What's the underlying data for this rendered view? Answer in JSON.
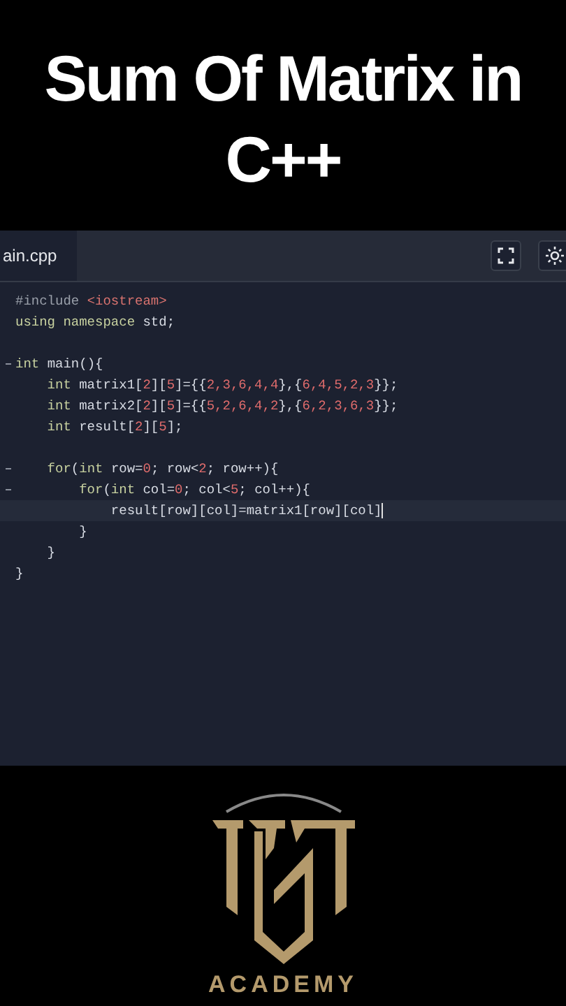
{
  "title": {
    "lines": [
      "Sum Of Matrix in",
      "C++"
    ]
  },
  "editor": {
    "tab": {
      "label": "ain.cpp"
    },
    "blocks": [
      {
        "lines": [
          {
            "tokens": [
              {
                "kind": "directive",
                "text": "#include "
              },
              {
                "kind": "string",
                "text": "<iostream>"
              }
            ]
          },
          {
            "tokens": [
              {
                "kind": "keyword",
                "text": "using namespace "
              },
              {
                "kind": "plain",
                "text": "std;"
              }
            ]
          }
        ]
      },
      {
        "lines": [
          {
            "fold": true,
            "tokens": [
              {
                "kind": "keyword",
                "text": "int "
              },
              {
                "kind": "plain",
                "text": "main(){"
              }
            ]
          },
          {
            "tokens": [
              {
                "kind": "keyword",
                "text": "    int "
              },
              {
                "kind": "plain",
                "text": "matrix1["
              },
              {
                "kind": "number",
                "text": "2"
              },
              {
                "kind": "plain",
                "text": "]["
              },
              {
                "kind": "number",
                "text": "5"
              },
              {
                "kind": "plain",
                "text": "]={{"
              },
              {
                "kind": "number",
                "text": "2,3,6,4,4"
              },
              {
                "kind": "plain",
                "text": "},{"
              },
              {
                "kind": "number",
                "text": "6,4,5,2,3"
              },
              {
                "kind": "plain",
                "text": "}};"
              }
            ]
          },
          {
            "tokens": [
              {
                "kind": "keyword",
                "text": "    int "
              },
              {
                "kind": "plain",
                "text": "matrix2["
              },
              {
                "kind": "number",
                "text": "2"
              },
              {
                "kind": "plain",
                "text": "]["
              },
              {
                "kind": "number",
                "text": "5"
              },
              {
                "kind": "plain",
                "text": "]={{"
              },
              {
                "kind": "number",
                "text": "5,2,6,4,2"
              },
              {
                "kind": "plain",
                "text": "},{"
              },
              {
                "kind": "number",
                "text": "6,2,3,6,3"
              },
              {
                "kind": "plain",
                "text": "}};"
              }
            ]
          },
          {
            "tokens": [
              {
                "kind": "keyword",
                "text": "    int "
              },
              {
                "kind": "plain",
                "text": "result["
              },
              {
                "kind": "number",
                "text": "2"
              },
              {
                "kind": "plain",
                "text": "]["
              },
              {
                "kind": "number",
                "text": "5"
              },
              {
                "kind": "plain",
                "text": "];"
              }
            ]
          }
        ]
      },
      {
        "lines": [
          {
            "fold": true,
            "tokens": [
              {
                "kind": "keyword",
                "text": "    for"
              },
              {
                "kind": "plain",
                "text": "("
              },
              {
                "kind": "keyword",
                "text": "int "
              },
              {
                "kind": "plain",
                "text": "row="
              },
              {
                "kind": "number",
                "text": "0"
              },
              {
                "kind": "plain",
                "text": "; row<"
              },
              {
                "kind": "number",
                "text": "2"
              },
              {
                "kind": "plain",
                "text": "; row++){"
              }
            ]
          },
          {
            "fold": true,
            "tokens": [
              {
                "kind": "keyword",
                "text": "        for"
              },
              {
                "kind": "plain",
                "text": "("
              },
              {
                "kind": "keyword",
                "text": "int "
              },
              {
                "kind": "plain",
                "text": "col="
              },
              {
                "kind": "number",
                "text": "0"
              },
              {
                "kind": "plain",
                "text": "; col<"
              },
              {
                "kind": "number",
                "text": "5"
              },
              {
                "kind": "plain",
                "text": "; col++){"
              }
            ]
          },
          {
            "current": true,
            "tokens": [
              {
                "kind": "plain",
                "text": "            result[row][col]=matrix1[row][col]"
              }
            ]
          },
          {
            "tokens": [
              {
                "kind": "plain",
                "text": "        }"
              }
            ]
          },
          {
            "tokens": [
              {
                "kind": "plain",
                "text": "    }"
              }
            ]
          },
          {
            "tokens": [
              {
                "kind": "plain",
                "text": "}"
              }
            ]
          }
        ]
      }
    ]
  },
  "logo": {
    "caption": "ACADEMY"
  }
}
